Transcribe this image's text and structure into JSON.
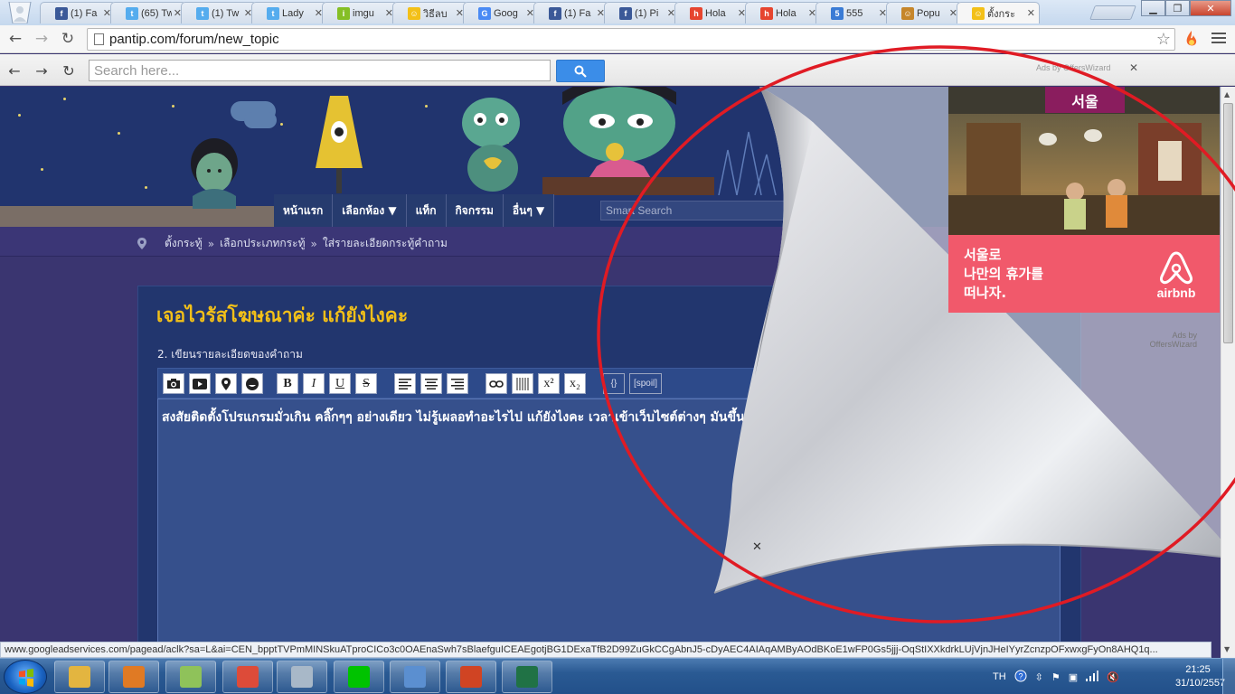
{
  "browser": {
    "tabs": [
      {
        "title": "(1) Fa",
        "icon": "facebook-icon",
        "color": "#3b5998",
        "glyph": "f"
      },
      {
        "title": "(65) Tw",
        "icon": "twitter-icon",
        "color": "#55acee",
        "glyph": "t"
      },
      {
        "title": "(1) Tw",
        "icon": "twitter-icon",
        "color": "#55acee",
        "glyph": "t"
      },
      {
        "title": "Lady",
        "icon": "twitter-icon",
        "color": "#55acee",
        "glyph": "t"
      },
      {
        "title": "imgu",
        "icon": "imgur-icon",
        "color": "#85bf25",
        "glyph": "i"
      },
      {
        "title": "วิธีลบ",
        "icon": "pantip-icon",
        "color": "#f3c018",
        "glyph": "☺"
      },
      {
        "title": "Goog",
        "icon": "google-translate-icon",
        "color": "#4a8af4",
        "glyph": "G"
      },
      {
        "title": "(1) Fa",
        "icon": "facebook-icon",
        "color": "#3b5998",
        "glyph": "f"
      },
      {
        "title": "(1) Pi",
        "icon": "facebook-icon",
        "color": "#3b5998",
        "glyph": "f"
      },
      {
        "title": "Hola",
        "icon": "hola-icon",
        "color": "#e6452f",
        "glyph": "h"
      },
      {
        "title": "Hola",
        "icon": "hola-icon",
        "color": "#e6452f",
        "glyph": "h"
      },
      {
        "title": "555",
        "icon": "globe-icon",
        "color": "#3a7bd5",
        "glyph": "5"
      },
      {
        "title": "Popu",
        "icon": "pantip-icon",
        "color": "#c6862b",
        "glyph": "☺"
      },
      {
        "title": "ตั้งกระ",
        "icon": "pantip-icon",
        "color": "#f3c018",
        "glyph": "☺",
        "active": true
      }
    ],
    "url": "pantip.com/forum/new_topic"
  },
  "toolbar": {
    "search_placeholder": "Search here...",
    "ads_label": "Ads by OffersWizard",
    "close_glyph": "✕"
  },
  "site": {
    "nav": [
      "หน้าแรก",
      "เลือกห้อง ▼",
      "แท็ก",
      "กิจกรรม",
      "อื่นๆ ▼"
    ],
    "search_placeholder": "Smart Search",
    "breadcrumb": [
      "ตั้งกระทู้",
      "เลือกประเภทกระทู้",
      "ใส่รายละเอียดกระทู้คำถาม"
    ],
    "breadcrumb_separator": "»",
    "topic_title": "เจอไวรัสโฆษณาค่ะ แก้ยังไงคะ",
    "step_label": "2. เขียนรายละเอียดของคำถาม",
    "editor_buttons": [
      {
        "name": "insert-photo-button",
        "label": "",
        "icon": "camera-icon"
      },
      {
        "name": "insert-video-button",
        "label": "",
        "icon": "play-icon"
      },
      {
        "name": "insert-map-button",
        "label": "",
        "icon": "map-pin-icon"
      },
      {
        "name": "insert-emoticon-button",
        "label": "",
        "icon": "smiley-icon"
      },
      {
        "name": "bold-button",
        "label": "B"
      },
      {
        "name": "italic-button",
        "label": "I"
      },
      {
        "name": "underline-button",
        "label": "U"
      },
      {
        "name": "strikethrough-button",
        "label": "S"
      },
      {
        "name": "align-left-button",
        "label": "",
        "icon": "align-left-icon"
      },
      {
        "name": "align-center-button",
        "label": "",
        "icon": "align-center-icon"
      },
      {
        "name": "align-right-button",
        "label": "",
        "icon": "align-right-icon"
      },
      {
        "name": "insert-link-button",
        "label": "",
        "icon": "link-icon"
      },
      {
        "name": "insert-line-button",
        "label": "",
        "icon": "hr-icon"
      },
      {
        "name": "superscript-button",
        "label": "x²"
      },
      {
        "name": "subscript-button",
        "label": "x₂"
      },
      {
        "name": "code-button",
        "label": "{}"
      },
      {
        "name": "spoil-button",
        "label": "[spoil]"
      }
    ],
    "editor_text": "สงสัยติดตั้งโปรแกรมมั่วเกิน  คลิ๊กๆๆ   อย่างเดียว ไม่รู้เผลอทำอะไรไป  แก้ยังไงคะ เวลาเข้าเว็บไซต์ต่างๆ มันขึ้นมาตลอด",
    "peel_close": "✕"
  },
  "side_ad": {
    "city": "서울",
    "headline_lines": [
      "서울로",
      "나만의 휴가를",
      "떠나자."
    ],
    "brand": "airbnb",
    "ads_by": [
      "Ads by",
      "OffersWizard"
    ],
    "colors": {
      "band": "#f1596b",
      "city_tag": "#8a1d5e"
    }
  },
  "status_url": "www.googleadservices.com/pagead/aclk?sa=L&ai=CEN_bpptTVPmMINSkuATproCICo3c0OAEnaSwh7sBlaefguICEAEgotjBG1DExaTfB2D99ZuGkCCgAbnJ5-cDyAEC4AIAqAMByAOdBKoE1wFP0Gs5jjj-OqStIXXkdrkLUjVjnJHeIYyrZcnzpOFxwxgFyOn8AHQ1q...",
  "taskbar": {
    "apps": [
      {
        "name": "taskbar-explorer",
        "color": "#e3b540"
      },
      {
        "name": "taskbar-media-player",
        "color": "#e07a24"
      },
      {
        "name": "taskbar-windows-explorer-2",
        "color": "#8fc25a"
      },
      {
        "name": "taskbar-chrome",
        "color": "#dd4b39"
      },
      {
        "name": "taskbar-calculator",
        "color": "#a8b8c8"
      },
      {
        "name": "taskbar-line",
        "color": "#00c300"
      },
      {
        "name": "taskbar-control-panel",
        "color": "#5b8fd0"
      },
      {
        "name": "taskbar-powerpoint",
        "color": "#d04423"
      },
      {
        "name": "taskbar-excel",
        "color": "#207245"
      }
    ],
    "language": "TH",
    "time": "21:25",
    "date": "31/10/2557"
  }
}
